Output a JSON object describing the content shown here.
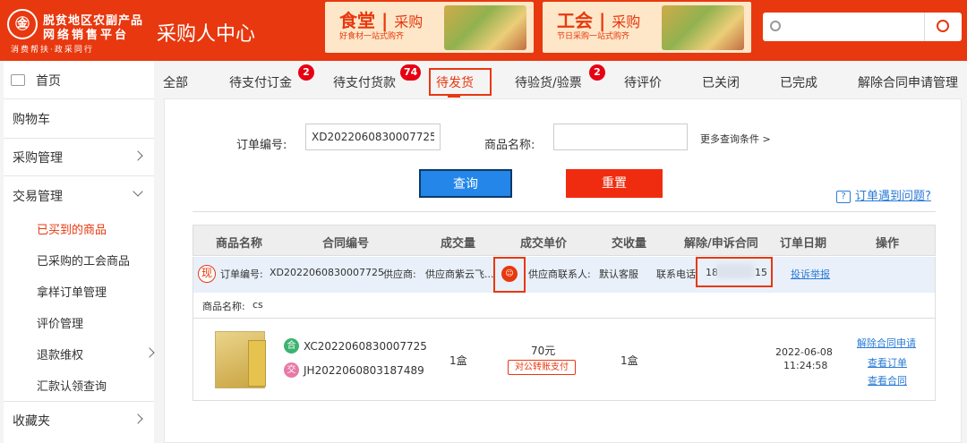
{
  "header": {
    "logo_mark": "㊎",
    "logo_line1": "脱贫地区农副产品",
    "logo_line2": "网络销售平台",
    "logo_line3": "消费帮扶·政采同行",
    "title": "采购人中心",
    "banners": [
      {
        "title": "食堂",
        "sub": "采购",
        "slogan": "好食材一站式购齐"
      },
      {
        "title": "工会",
        "sub": "采购",
        "slogan": "节日采购一站式购齐"
      }
    ],
    "search_placeholder": ""
  },
  "sidebar": {
    "home": "首页",
    "cart": "购物车",
    "purchase_mgmt": "采购管理",
    "trade_mgmt": "交易管理",
    "trade_sub": [
      "已买到的商品",
      "已采购的工会商品",
      "拿样订单管理",
      "评价管理",
      "退款维权",
      "汇款认领查询"
    ],
    "favorites": "收藏夹"
  },
  "tabs": [
    {
      "label": "全部"
    },
    {
      "label": "待支付订金",
      "badge": "2"
    },
    {
      "label": "待支付货款",
      "badge": "74"
    },
    {
      "label": "待发货"
    },
    {
      "label": "待验货/验票",
      "badge": "2"
    },
    {
      "label": "待评价"
    },
    {
      "label": "已关闭"
    },
    {
      "label": "已完成"
    },
    {
      "label": "解除合同申请管理"
    }
  ],
  "filters": {
    "order_no_label": "订单编号:",
    "order_no_value": "XD2022060830007725",
    "product_name_label": "商品名称:",
    "product_name_value": "",
    "more_conditions": "更多查询条件 >",
    "query_button": "查询",
    "reset_button": "重置",
    "help_icon": "?",
    "help_link": "订单遇到问题?"
  },
  "table": {
    "headers": [
      "商品名称",
      "合同编号",
      "成交量",
      "成交单价",
      "交收量",
      "解除/申诉合同",
      "订单日期",
      "操作"
    ],
    "order": {
      "tag": "现",
      "order_no_label": "订单编号:",
      "order_no": "XD2022060830007725",
      "supplier_label": "供应商:",
      "supplier": "供应商紫云飞...",
      "contact_label": "供应商联系人:",
      "contact": "默认客服",
      "phone_label": "联系电话",
      "phone_prefix": "18",
      "phone_suffix": "15",
      "report_link": "投诉举报",
      "avatar_icon": "☺"
    },
    "product_name_label": "商品名称:",
    "product_name": "cs",
    "item": {
      "contract_badge": "合",
      "contract_no": "XC2022060830007725",
      "trade_badge": "交",
      "trade_no": "JH2022060803187489",
      "quantity": "1盒",
      "price": "70元",
      "pay_method": "对公转账支付",
      "delivered": "1盒",
      "date": "2022-06-08",
      "time": "11:24:58",
      "actions": [
        "解除合同申请",
        "查看订单",
        "查看合同"
      ]
    }
  },
  "colors": {
    "brand": "#e8380f",
    "query_btn": "#2386e8",
    "reset_btn": "#f02c10",
    "link": "#2a7bd6",
    "badge": "#e60012"
  }
}
